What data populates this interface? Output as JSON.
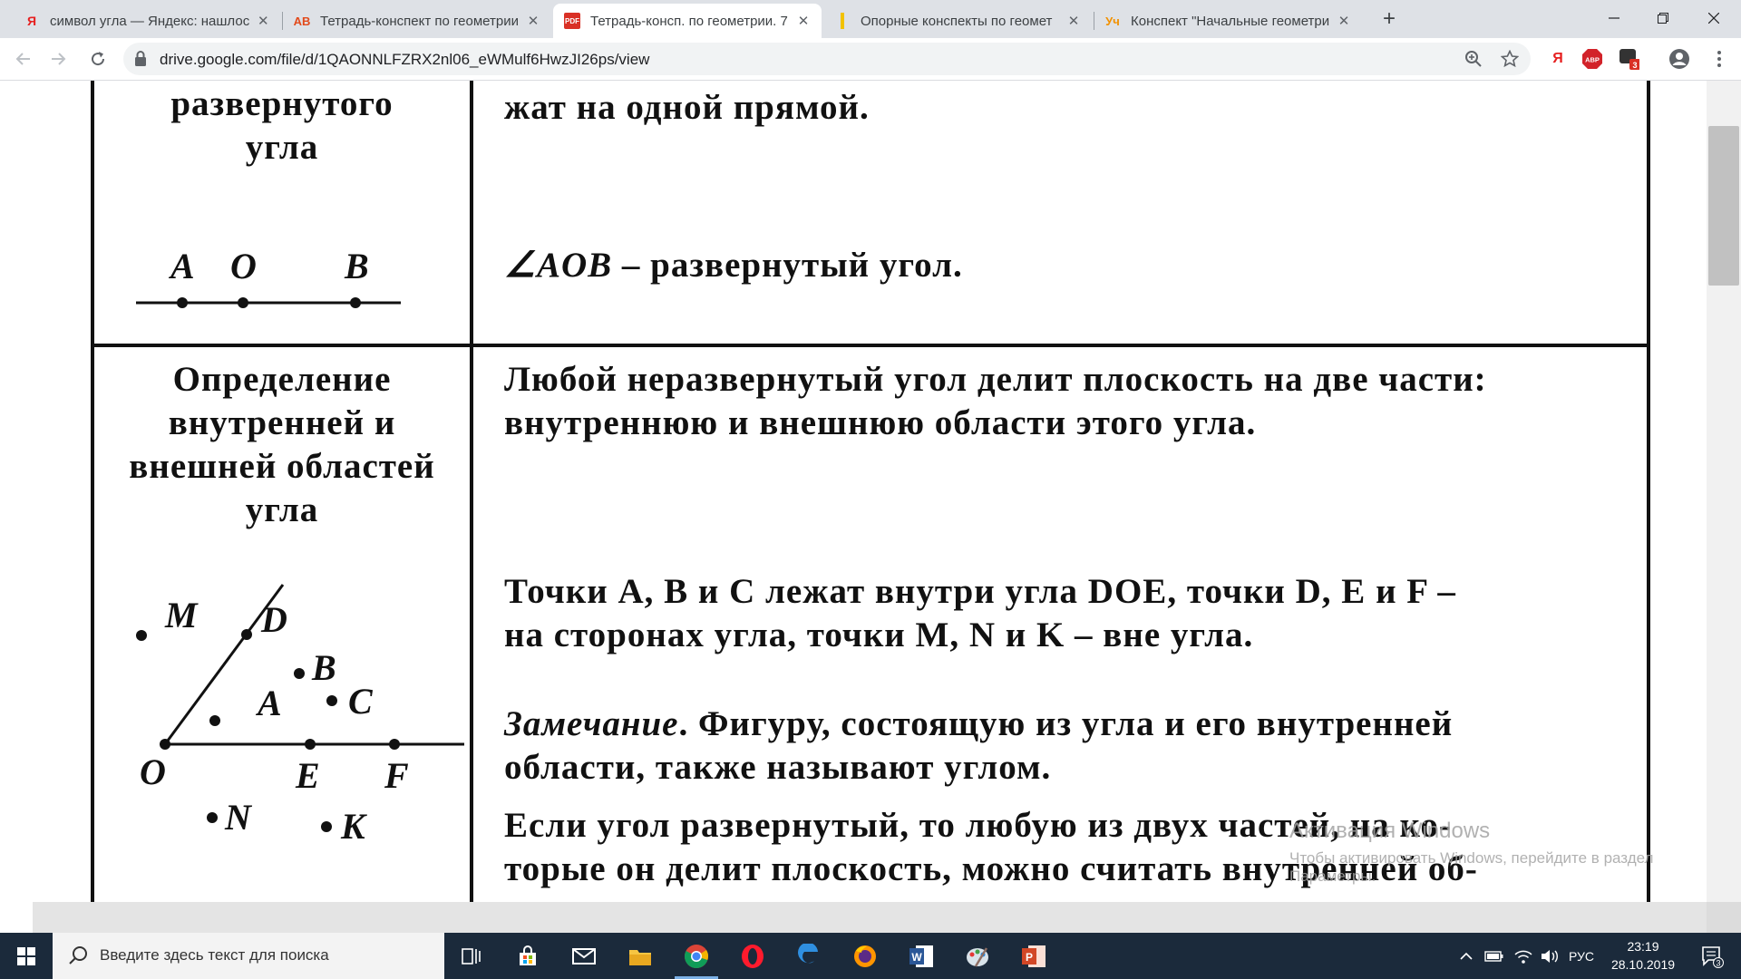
{
  "tabs": [
    {
      "title": "символ угла — Яндекс: нашлось",
      "favicon_text": "Я",
      "favicon_color": "#e62020"
    },
    {
      "title": "Тетрадь-конспект по геометрии",
      "favicon_text": "AB",
      "favicon_color": "#e24a1b"
    },
    {
      "title": "Тетрадь-консп. по геометрии. 7",
      "favicon_text": "PDF",
      "favicon_color": "#d93025",
      "active": true
    },
    {
      "title": "Опорные конспекты по геомет",
      "favicon_text": "",
      "favicon_color": "#f2c200"
    },
    {
      "title": "Конспект \"Начальные геометри",
      "favicon_text": "Уч",
      "favicon_color": "#f29100"
    }
  ],
  "new_tab_label": "+",
  "toolbar": {
    "url": "drive.google.com/file/d/1QAONNLFZRX2nl06_eWMulf6HwzJI26ps/view",
    "ext_yandex": "Я",
    "ext_abp": "ABP",
    "ext_badge": "3"
  },
  "document": {
    "row1": {
      "heading": [
        "развернутого",
        "угла"
      ],
      "text_top": "жат на одной прямой.",
      "figure_labels": [
        "A",
        "O",
        "B"
      ],
      "statement_angle": "∠AOB",
      "statement_rest": " – развернутый угол."
    },
    "row2": {
      "heading": [
        "Определение",
        "внутренней и",
        "внешней областей",
        "угла"
      ],
      "line1": "Любой неразвернутый угол делит плоскость на две части:",
      "line2_a": "внутреннюю",
      "line2_b": " и ",
      "line2_c": "внешнюю области",
      "line2_d": " этого ",
      "line2_e": "угла",
      "line2_f": ".",
      "points_line1": "Точки A, B и C лежат внутри угла DOE, точки D, E и F –",
      "points_line2": "на сторонах угла, точки M, N и K – вне угла.",
      "remark_title": "Замечание",
      "remark_line1_rest": ". Фигуру, состоящую из угла и его внутренней",
      "remark_line2": "области, также называют углом.",
      "last_line1": "Если угол развернутый, то любую из двух частей, на ко-",
      "last_line2": "торые он делит плоскость, можно считать внутренней об-",
      "figure_labels": [
        "M",
        "D",
        "B",
        "A",
        "C",
        "O",
        "E",
        "F",
        "N",
        "K"
      ]
    },
    "watermark_title": "Активация Windows",
    "watermark_text": "Чтобы активировать Windows, перейдите в раздел",
    "watermark_text2": "Параметры."
  },
  "taskbar": {
    "search_placeholder": "Введите здесь текст для поиска",
    "lang": "РУС",
    "time": "23:19",
    "date": "28.10.2019",
    "notifications_badge": "3"
  }
}
